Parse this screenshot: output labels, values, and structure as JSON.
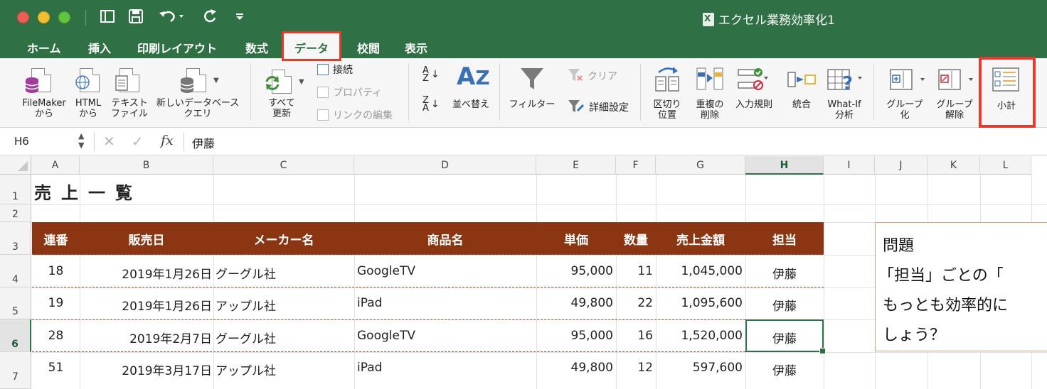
{
  "window": {
    "title": "エクセル業務効率化1"
  },
  "tabs": [
    {
      "label": "ホーム"
    },
    {
      "label": "挿入"
    },
    {
      "label": "印刷レイアウト"
    },
    {
      "label": "数式"
    },
    {
      "label": "データ",
      "active": true
    },
    {
      "label": "校閲"
    },
    {
      "label": "表示"
    }
  ],
  "ribbon": {
    "filemaker": [
      "FileMaker",
      "から"
    ],
    "html": [
      "HTML",
      "から"
    ],
    "text_file": [
      "テキスト",
      "ファイル"
    ],
    "new_db_query": [
      "新しいデータベース",
      "クエリ"
    ],
    "refresh_all": [
      "すべて",
      "更新"
    ],
    "connections": "接続",
    "properties": "プロパティ",
    "edit_links": "リンクの編集",
    "sort": "並べ替え",
    "filter": "フィルター",
    "clear": "クリア",
    "advanced": "詳細設定",
    "text_to_columns": [
      "区切り",
      "位置"
    ],
    "remove_duplicates": [
      "重複の",
      "削除"
    ],
    "data_validation": "入力規則",
    "consolidate": "統合",
    "what_if": [
      "What-If",
      "分析"
    ],
    "group": [
      "グループ",
      "化"
    ],
    "ungroup": [
      "グループ",
      "解除"
    ],
    "subtotal": "小計",
    "accent_color": "#e53b2a"
  },
  "formula_bar": {
    "name_box": "H6",
    "fx": "fx",
    "value": "伊藤"
  },
  "grid": {
    "columns": [
      "A",
      "B",
      "C",
      "D",
      "E",
      "F",
      "G",
      "H",
      "I",
      "J",
      "K",
      "L"
    ],
    "rows": [
      "1",
      "2",
      "3",
      "4",
      "5",
      "6",
      "7"
    ],
    "selected_column": "H",
    "selected_row": "6",
    "title": "売上一覧",
    "headers": [
      "連番",
      "販売日",
      "メーカー名",
      "商品名",
      "単価",
      "数量",
      "売上金額",
      "担当"
    ],
    "data_rows": [
      {
        "no": "18",
        "date": "2019年1月26日",
        "maker": "グーグル社",
        "product": "GoogleTV",
        "price": "95,000",
        "qty": "11",
        "amount": "1,045,000",
        "staff": "伊藤"
      },
      {
        "no": "19",
        "date": "2019年1月26日",
        "maker": "アップル社",
        "product": "iPad",
        "price": "49,800",
        "qty": "22",
        "amount": "1,095,600",
        "staff": "伊藤"
      },
      {
        "no": "28",
        "date": "2019年2月7日",
        "maker": "グーグル社",
        "product": "GoogleTV",
        "price": "95,000",
        "qty": "16",
        "amount": "1,520,000",
        "staff": "伊藤"
      },
      {
        "no": "51",
        "date": "2019年3月17日",
        "maker": "アップル社",
        "product": "iPad",
        "price": "49,800",
        "qty": "12",
        "amount": "597,600",
        "staff": "伊藤"
      }
    ],
    "header_color": "#8b3513"
  },
  "question_box": {
    "lines": [
      "問題",
      "「担当」ごとの「",
      "もっとも効率的に",
      "しょう？"
    ]
  }
}
